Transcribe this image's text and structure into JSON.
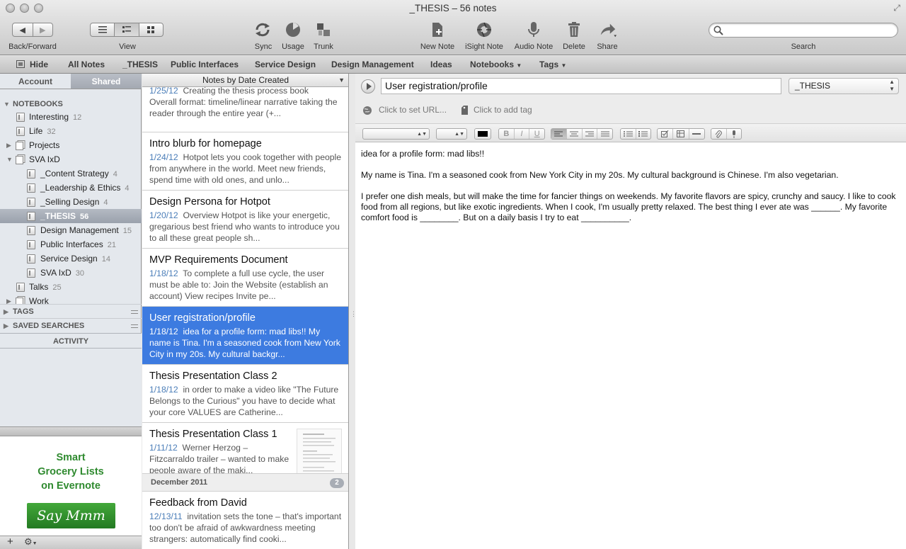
{
  "window": {
    "title": "_THESIS – 56 notes"
  },
  "toolbar": {
    "back_forward_label": "Back/Forward",
    "view_label": "View",
    "sync_label": "Sync",
    "usage_label": "Usage",
    "trunk_label": "Trunk",
    "new_note_label": "New Note",
    "isight_note_label": "iSight Note",
    "audio_note_label": "Audio Note",
    "delete_label": "Delete",
    "share_label": "Share",
    "search_label": "Search",
    "search_placeholder": ""
  },
  "shortcuts": {
    "hide": "Hide",
    "items": [
      "All Notes",
      "_THESIS",
      "Public Interfaces",
      "Service Design",
      "Design Management",
      "Ideas"
    ],
    "notebooks": "Notebooks",
    "tags": "Tags"
  },
  "sidebar": {
    "tabs": [
      "Account",
      "Shared"
    ],
    "notebooks_header": "NOTEBOOKS",
    "notebooks": [
      {
        "name": "Interesting",
        "count": "12"
      },
      {
        "name": "Life",
        "count": "32"
      },
      {
        "name": "Projects",
        "count": ""
      },
      {
        "name": "SVA IxD",
        "count": ""
      },
      {
        "name": "_Content Strategy",
        "count": "4"
      },
      {
        "name": "_Leadership & Ethics",
        "count": "4"
      },
      {
        "name": "_Selling Design",
        "count": "4"
      },
      {
        "name": "_THESIS",
        "count": "56"
      },
      {
        "name": "Design Management",
        "count": "15"
      },
      {
        "name": "Public Interfaces",
        "count": "21"
      },
      {
        "name": "Service Design",
        "count": "14"
      },
      {
        "name": "SVA IxD",
        "count": "30"
      },
      {
        "name": "Talks",
        "count": "25"
      },
      {
        "name": "Work",
        "count": ""
      }
    ],
    "tags_header": "TAGS",
    "saved_searches_header": "SAVED SEARCHES",
    "activity_header": "ACTIVITY",
    "ad": {
      "line1": "Smart",
      "line2": "Grocery Lists",
      "line3": "on Evernote",
      "button": "Say Mmm"
    }
  },
  "note_list": {
    "sort_label": "Notes by Date Created",
    "notes": [
      {
        "title": "",
        "date": "1/25/12",
        "snippet_top": "Creating the thesis process book",
        "snippet": "Overall format: timeline/linear narrative taking the reader through the entire year (+..."
      },
      {
        "title": "Intro blurb for homepage",
        "date": "1/24/12",
        "snippet": "Hotpot lets you cook together with people from anywhere in the world. Meet new friends, spend time with old ones, and unlo..."
      },
      {
        "title": "Design Persona for Hotpot",
        "date": "1/20/12",
        "snippet": "Overview Hotpot is like your energetic, gregarious best friend who wants to introduce you to all these great people sh..."
      },
      {
        "title": "MVP Requirements Document",
        "date": "1/18/12",
        "snippet": "To complete a full use cycle, the user must be able to: Join the Website (establish an account) View recipes Invite pe..."
      },
      {
        "title": "User registration/profile",
        "date": "1/18/12",
        "snippet": "idea for a profile form: mad libs!! My name is Tina. I'm a seasoned cook from New York City in my 20s. My cultural backgr..."
      },
      {
        "title": "Thesis Presentation Class 2",
        "date": "1/18/12",
        "snippet": "in order to make a video like \"The Future Belongs to the Curious\" you have to decide what your core VALUES are Catherine..."
      },
      {
        "title": "Thesis Presentation Class 1",
        "date": "1/11/12",
        "snippet": "Werner Herzog – Fitzcarraldo trailer – wanted to make people aware of the maki..."
      },
      {
        "title": "Feedback from David",
        "date": "12/13/11",
        "snippet": "invitation sets the tone – that's important too don't be afraid of awkwardness meeting strangers: automatically find cooki..."
      }
    ],
    "month_header": "December 2011",
    "month_count": "2"
  },
  "editor": {
    "title": "User registration/profile",
    "notebook": "_THESIS",
    "url_placeholder": "Click to set URL...",
    "tag_placeholder": "Click to add tag",
    "paragraphs": [
      "idea for a profile form: mad libs!!",
      "My name is Tina. I'm a seasoned cook from New York City in my 20s. My cultural background is Chinese. I'm also vegetarian.",
      "I prefer one dish meals, but will make the time for fancier things on weekends. My favorite flavors are spicy, crunchy and saucy. I like to cook food from all regions, but like exotic ingredients. When I cook, I'm usually pretty relaxed. The best thing I ever ate was ______. My favorite comfort food is ________. But on a daily basis I try to eat __________."
    ]
  }
}
